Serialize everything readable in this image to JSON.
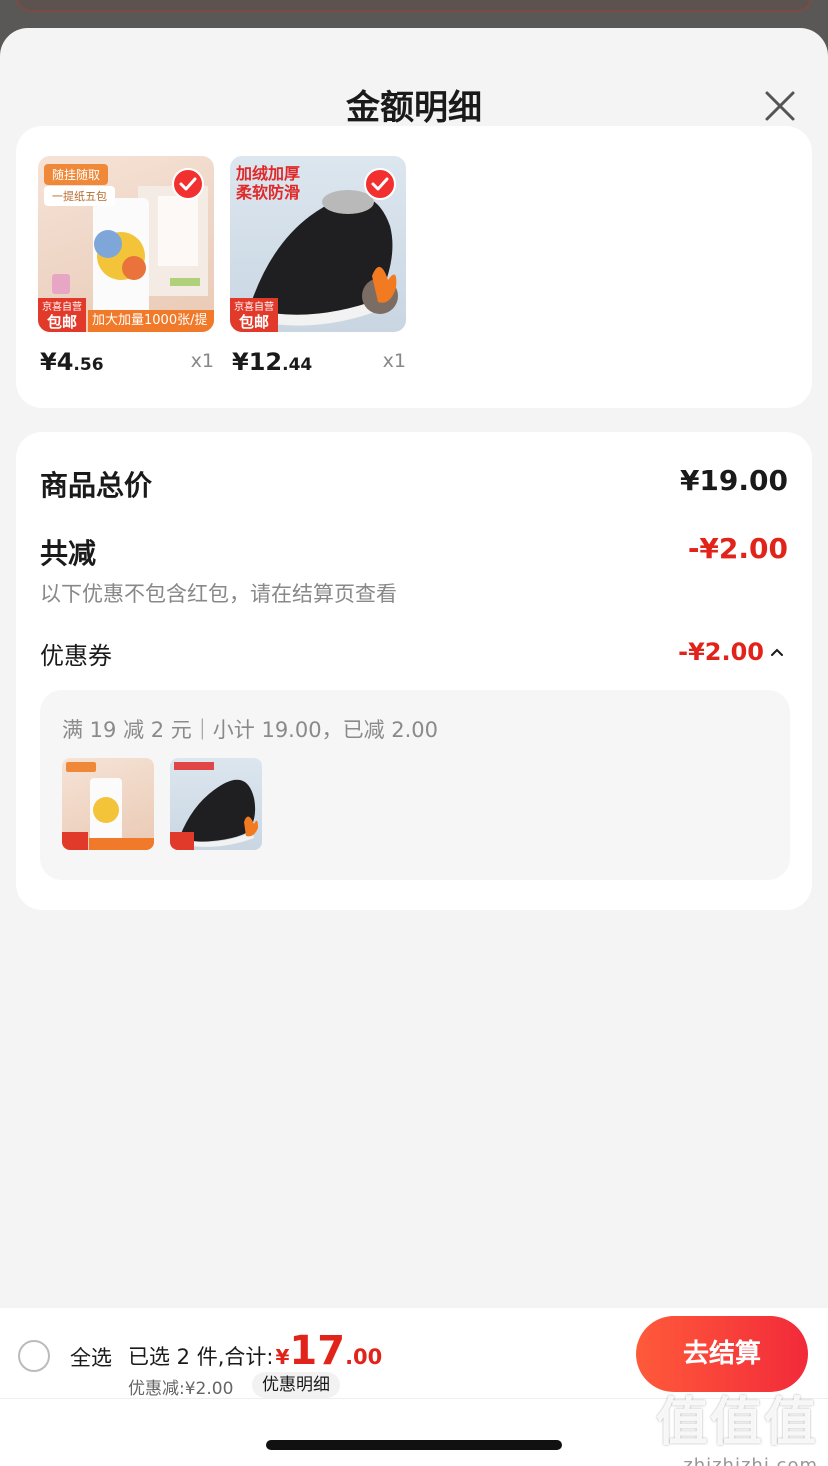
{
  "sheet": {
    "title": "金额明细"
  },
  "products": [
    {
      "price_int": "¥4",
      "price_dec": ".56",
      "qty": "x1",
      "tag_top": "随挂随取",
      "tag_sub": "一提纸五包",
      "badge_line1": "京喜自营",
      "badge_line2": "包邮",
      "banner": "加大加量1000张/提"
    },
    {
      "price_int": "¥12",
      "price_dec": ".44",
      "qty": "x1",
      "headline_1": "加绒加厚",
      "headline_2": "柔软防滑",
      "badge_line1": "京喜自营",
      "badge_line2": "包邮"
    }
  ],
  "summary": {
    "total_label": "商品总价",
    "total_value": "¥19.00",
    "discount_label": "共减",
    "discount_value": "-¥2.00",
    "note": "以下优惠不包含红包，请在结算页查看",
    "coupon_label": "优惠券",
    "coupon_value": "-¥2.00",
    "coupon_desc": "满 19 减 2 元｜小计 19.00，已减 2.00"
  },
  "bottom": {
    "select_all": "全选",
    "selected_text": "已选 2 件,合计:",
    "total_yen": "¥",
    "total_int": "17",
    "total_dec": ".00",
    "discount_line": "优惠减:¥2.00",
    "detail_chip": "优惠明细",
    "checkout": "去结算"
  },
  "watermark": {
    "big": "值值值",
    "small": "zhizhizhi.com"
  },
  "colors": {
    "accent_red": "#e2231a",
    "checkout_gradient_start": "#ff5a3a",
    "checkout_gradient_end": "#f22a3a"
  }
}
